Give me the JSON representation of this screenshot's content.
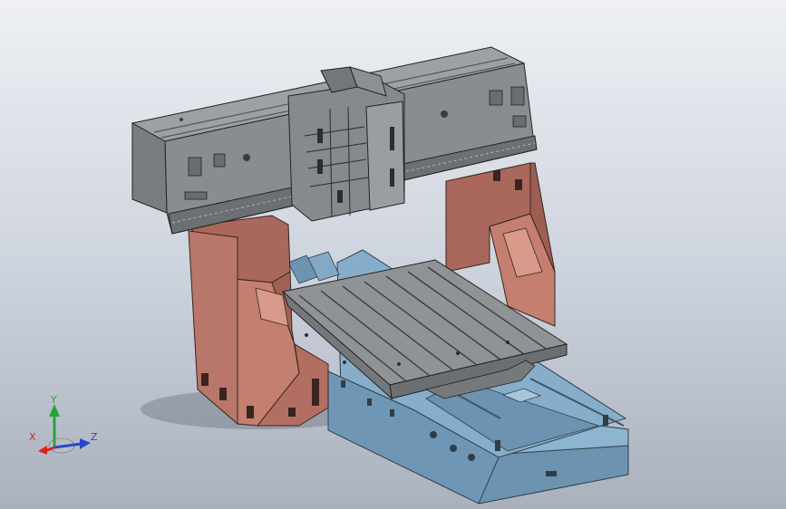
{
  "viewport": {
    "background_top": "#eef0f4",
    "background_bottom": "#a9b1bd"
  },
  "model": {
    "parts": [
      {
        "name": "gantry-crossbeam",
        "color": "#8a8d8f"
      },
      {
        "name": "spindle-head-carriage",
        "color": "#86898b"
      },
      {
        "name": "left-column",
        "color": "#b9786a"
      },
      {
        "name": "right-column",
        "color": "#b9786a"
      },
      {
        "name": "worktable",
        "color": "#83878a"
      },
      {
        "name": "machine-bed",
        "color": "#7ea7c4"
      }
    ]
  },
  "triad": {
    "x_label": "X",
    "y_label": "Y",
    "z_label": "Z",
    "x_color": "#d9241b",
    "y_color": "#2aa33b",
    "z_color": "#2947c9"
  }
}
